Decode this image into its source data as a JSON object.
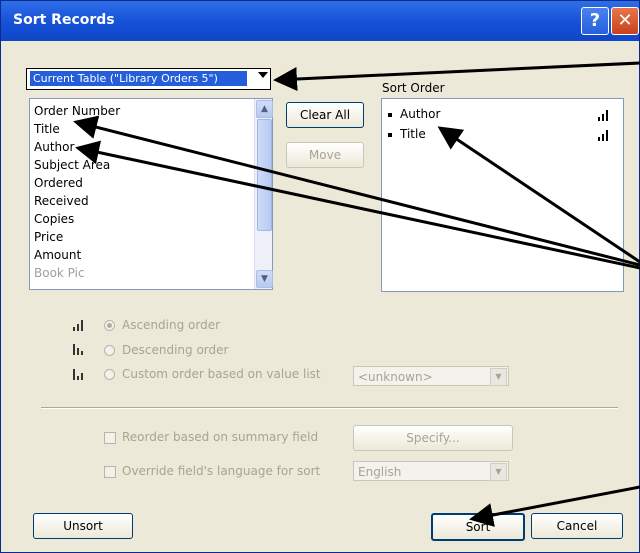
{
  "window": {
    "title": "Sort Records",
    "help_glyph": "?",
    "close_glyph": "✕"
  },
  "table_popup": {
    "selected": "Current Table (\"Library Orders 5\")"
  },
  "fields_list": {
    "items": [
      "Order Number",
      "Title",
      "Author",
      "Subject Area",
      "Ordered",
      "Received",
      "Copies",
      "Price",
      "Amount",
      "Book Pic"
    ]
  },
  "buttons": {
    "clear_all": "Clear All",
    "move": "Move",
    "unsort": "Unsort",
    "sort": "Sort",
    "cancel": "Cancel",
    "specify": "Specify..."
  },
  "sort_order": {
    "label": "Sort Order",
    "items": [
      "Author",
      "Title"
    ],
    "icon": "ascending-bars-icon"
  },
  "order_options": {
    "ascending": "Ascending order",
    "descending": "Descending order",
    "custom": "Custom order based on value list",
    "value_list": "<unknown>"
  },
  "options": {
    "reorder_label": "Reorder based on summary field",
    "override_label": "Override field's language for sort",
    "language": "English"
  },
  "colors": {
    "titlebar": "#1550d6",
    "selection": "#245edb",
    "dialog_bg": "#ece9d8"
  }
}
